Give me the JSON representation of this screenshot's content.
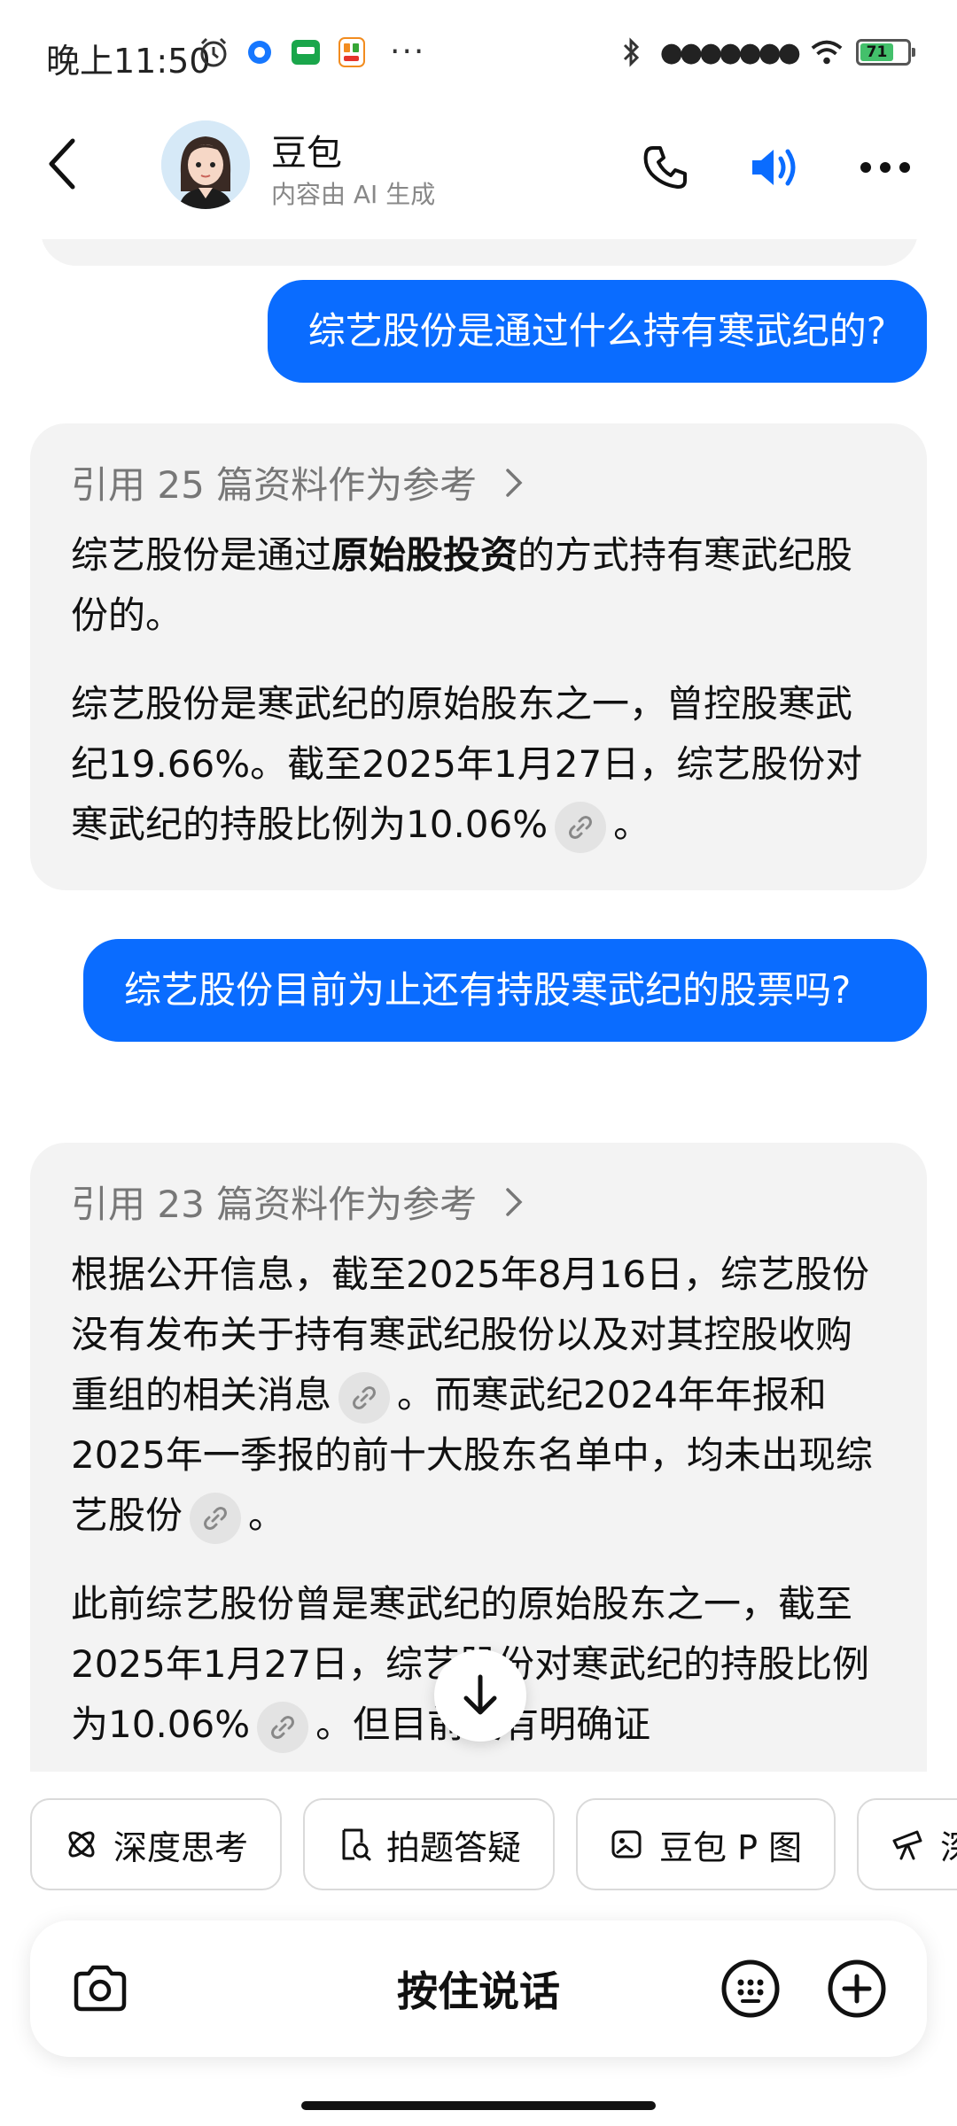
{
  "status": {
    "time": "晚上11:50",
    "battery": "71",
    "notif_icons": [
      "alarm-icon",
      "app-o-icon",
      "guazi-app-icon",
      "58-app-icon"
    ],
    "more_dots": "···"
  },
  "header": {
    "name": "豆包",
    "subtitle": "内容由 AI 生成"
  },
  "messages": [
    {
      "role": "user",
      "text": "综艺股份是通过什么持有寒武纪的?"
    },
    {
      "role": "bot",
      "ref": "引用 25 篇资料作为参考",
      "p1_a": "综艺股份是通过",
      "p1_bold": "原始股投资",
      "p1_b": "的方式持有寒武纪股份的。",
      "p2_a": "综艺股份是寒武纪的原始股东之一，曾控股寒武纪19.66%。截至2025年1月27日，综艺股份对寒武纪的持股比例为10.06%",
      "p2_b": "。"
    },
    {
      "role": "user",
      "text": "综艺股份目前为止还有持股寒武纪的股票吗?"
    },
    {
      "role": "bot",
      "ref": "引用 23 篇资料作为参考",
      "p1_a": "根据公开信息，截至2025年8月16日，综艺股份没有发布关于持有寒武纪股份以及对其控股收购重组的相关消息",
      "p1_b": "。而寒武纪2024年年报和2025年一季报的前十大股东名单中，均未出现综艺股份",
      "p1_c": "。",
      "p2_a": "此前综艺股份曾是寒武纪的原始股东之一，截至2025年1月27日，综艺股份对寒武纪的持股比例为10.06%",
      "p2_b": "。但目前没有明确证"
    }
  ],
  "quick_actions": [
    "深度思考",
    "拍题答疑",
    "豆包 P 图",
    "深入研究"
  ],
  "input": {
    "hold_to_talk": "按住说话"
  },
  "colors": {
    "user_bubble": "#0a6cff",
    "bot_bubble": "#f3f3f3",
    "speaker_accent": "#0a6cff"
  }
}
